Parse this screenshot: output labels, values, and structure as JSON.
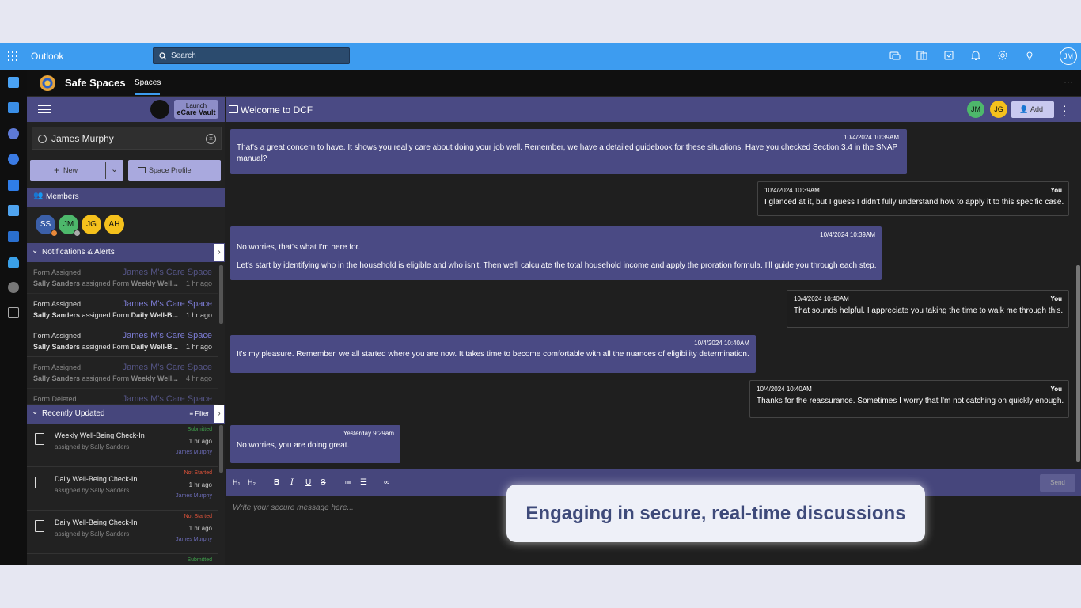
{
  "topbar": {
    "app_name": "Outlook",
    "search_placeholder": "Search",
    "user_initials": "JM"
  },
  "app": {
    "brand": "Safe Spaces",
    "tab": "Spaces"
  },
  "left": {
    "launch_line1": "Launch",
    "launch_line2": "eCare Vault",
    "user_name": "James Murphy",
    "new_label": "New",
    "space_profile_label": "Space Profile",
    "members_label": "Members",
    "members": [
      {
        "initials": "SS",
        "color": "#3b5fa8"
      },
      {
        "initials": "JM",
        "color": "#4db86b"
      },
      {
        "initials": "JG",
        "color": "#f5c11c"
      },
      {
        "initials": "AH",
        "color": "#f5c11c"
      }
    ],
    "notifications_label": "Notifications & Alerts",
    "notifications": [
      {
        "type": "Form Assigned",
        "space": "James M's Care Space",
        "who": "Sally Sanders",
        "verb": "assigned Form",
        "form": "Weekly Well...",
        "ago": "1 hr ago"
      },
      {
        "type": "Form Assigned",
        "space": "James M's Care Space",
        "who": "Sally Sanders",
        "verb": "assigned Form",
        "form": "Daily Well-B...",
        "ago": "1 hr ago"
      },
      {
        "type": "Form Assigned",
        "space": "James M's Care Space",
        "who": "Sally Sanders",
        "verb": "assigned Form",
        "form": "Daily Well-B...",
        "ago": "1 hr ago"
      },
      {
        "type": "Form Assigned",
        "space": "James M's Care Space",
        "who": "Sally Sanders",
        "verb": "assigned Form",
        "form": "Weekly Well...",
        "ago": "4 hr ago"
      },
      {
        "type": "Form Deleted",
        "space": "James M's Care Space"
      }
    ],
    "recent_label": "Recently Updated",
    "filter_label": "Filter",
    "recent": [
      {
        "title": "Weekly Well-Being Check-In",
        "assigned": "assigned by Sally Sanders",
        "status": "Submitted",
        "status_color": "#3fa14c",
        "ago": "1 hr ago",
        "by": "James Murphy"
      },
      {
        "title": "Daily Well-Being Check-In",
        "assigned": "assigned by Sally Sanders",
        "status": "Not Started",
        "status_color": "#e0533a",
        "ago": "1 hr ago",
        "by": "James Murphy"
      },
      {
        "title": "Daily Well-Being Check-In",
        "assigned": "assigned by Sally Sanders",
        "status": "Not Started",
        "status_color": "#e0533a",
        "ago": "1 hr ago",
        "by": "James Murphy"
      },
      {
        "status": "Submitted",
        "status_color": "#3fa14c"
      }
    ]
  },
  "chat": {
    "title": "Welcome to DCF",
    "participants": [
      {
        "initials": "JM",
        "color": "#4db86b"
      },
      {
        "initials": "JG",
        "color": "#f5c11c"
      }
    ],
    "add_label": "Add",
    "messages": [
      {
        "time": "10/4/2024 10:39AM",
        "text": "That's a great concern to have. It shows you really care about doing your job well. Remember, we have a detailed guidebook for these situations. Have you checked Section 3.4 in the SNAP",
        "text2": "manual?"
      },
      {
        "time": "10/4/2024 10:39AM",
        "who": "You",
        "text": "I glanced at it, but I guess I didn't fully understand how to apply it to this specific case."
      },
      {
        "time": "10/4/2024 10:39AM",
        "text": "No worries, that's what I'm here for.",
        "text2": "Let's start by identifying who in the household is eligible and who isn't. Then we'll calculate the total household income and apply the proration formula. I'll guide you through each step."
      },
      {
        "time": "10/4/2024 10:40AM",
        "who": "You",
        "text": "That sounds helpful. I appreciate you taking the time to walk me through this."
      },
      {
        "time": "10/4/2024 10:40AM",
        "text": "It's my pleasure. Remember, we all started where you are now. It takes time to become comfortable with all the nuances of eligibility determination."
      },
      {
        "time": "10/4/2024 10:40AM",
        "who": "You",
        "text": "Thanks for the reassurance. Sometimes I worry that I'm not catching on quickly enough."
      },
      {
        "time": "Yesterday 9:29am",
        "text": "No worries, you are doing great."
      }
    ],
    "send_label": "Send",
    "compose_placeholder": "Write your secure message here..."
  },
  "caption": "Engaging in secure, real-time discussions"
}
